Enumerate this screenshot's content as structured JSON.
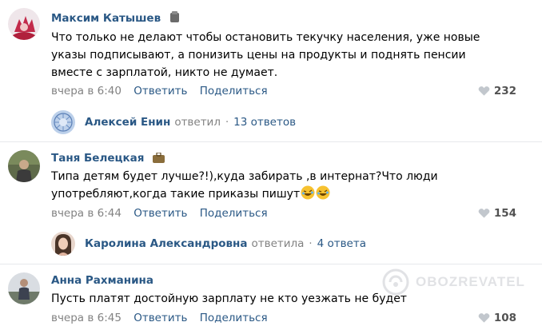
{
  "comments": [
    {
      "author": "Максим Катышев",
      "text_lines": [
        "Что только не делают чтобы остановить текучку населения, уже новые",
        "указы подписывают, а понизить цены на продукты и поднять пенсии",
        "вместе с зарплатой, никто не думает."
      ],
      "time": "вчера в 6:40",
      "reply_label": "Ответить",
      "share_label": "Поделиться",
      "likes": "232",
      "reply_thread": {
        "author": "Алексей Енин",
        "verb": "ответил",
        "count": "13 ответов"
      }
    },
    {
      "author": "Таня Белецкая",
      "text_lines": [
        "Типа детям будет лучше?!),куда забирать ,в интернат?Что люди",
        "употребляют,когда такие приказы пишут"
      ],
      "time": "вчера в 6:44",
      "reply_label": "Ответить",
      "share_label": "Поделиться",
      "likes": "154",
      "reply_thread": {
        "author": "Каролина Александровна",
        "verb": "ответила",
        "count": "4 ответа"
      }
    },
    {
      "author": "Анна Рахманина",
      "text_lines": [
        "Пусть платят достойную зарплату не кто уезжать не будет"
      ],
      "time": "вчера в 6:45",
      "reply_label": "Ответить",
      "share_label": "Поделиться",
      "likes": "108"
    }
  ],
  "watermark": "OBOZREVATEL",
  "icons": {
    "like": "heart-icon",
    "laugh": "rolling-laugh-emoji-icon",
    "author_badge": "flag-badge-icon"
  },
  "colors": {
    "link": "#2a5885",
    "meta": "#828282",
    "divider": "#e7e8ec"
  }
}
